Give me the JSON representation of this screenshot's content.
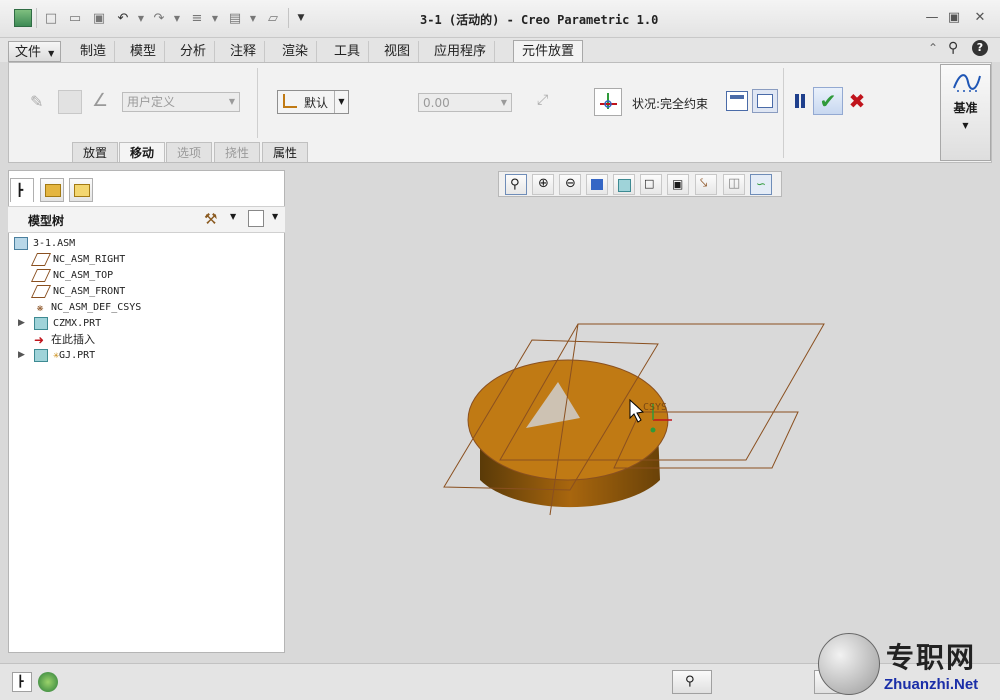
{
  "window": {
    "title": "3-1 (活动的) - Creo Parametric 1.0"
  },
  "tabs": [
    {
      "label": "文件"
    },
    {
      "label": "制造"
    },
    {
      "label": "模型"
    },
    {
      "label": "分析"
    },
    {
      "label": "注释"
    },
    {
      "label": "渲染"
    },
    {
      "label": "工具"
    },
    {
      "label": "视图"
    },
    {
      "label": "应用程序"
    },
    {
      "label": "元件放置"
    }
  ],
  "ribbon": {
    "constraint_type": "用户定义",
    "constraint_default": "默认",
    "offset_value": "0.00",
    "status_text": "状况:完全约束",
    "datum_label": "基准"
  },
  "subtabs": [
    {
      "label": "放置"
    },
    {
      "label": "移动"
    },
    {
      "label": "选项"
    },
    {
      "label": "挠性"
    },
    {
      "label": "属性"
    }
  ],
  "model_tree": {
    "title": "模型树",
    "items": [
      {
        "label": "3-1.ASM"
      },
      {
        "label": "NC_ASM_RIGHT"
      },
      {
        "label": "NC_ASM_TOP"
      },
      {
        "label": "NC_ASM_FRONT"
      },
      {
        "label": "NC_ASM_DEF_CSYS"
      },
      {
        "label": "CZMX.PRT"
      },
      {
        "label": "在此插入"
      },
      {
        "label": "GJ.PRT"
      }
    ]
  },
  "viewport": {
    "csys_label": "CSYS"
  },
  "watermark": {
    "cn": "专职网",
    "url": "Zhuanzhi.Net"
  },
  "colors": {
    "accent_green": "#2f9a3a",
    "cancel_red": "#c0141c",
    "model_orange": "#c07a14",
    "datum_brown": "#8a5020"
  }
}
